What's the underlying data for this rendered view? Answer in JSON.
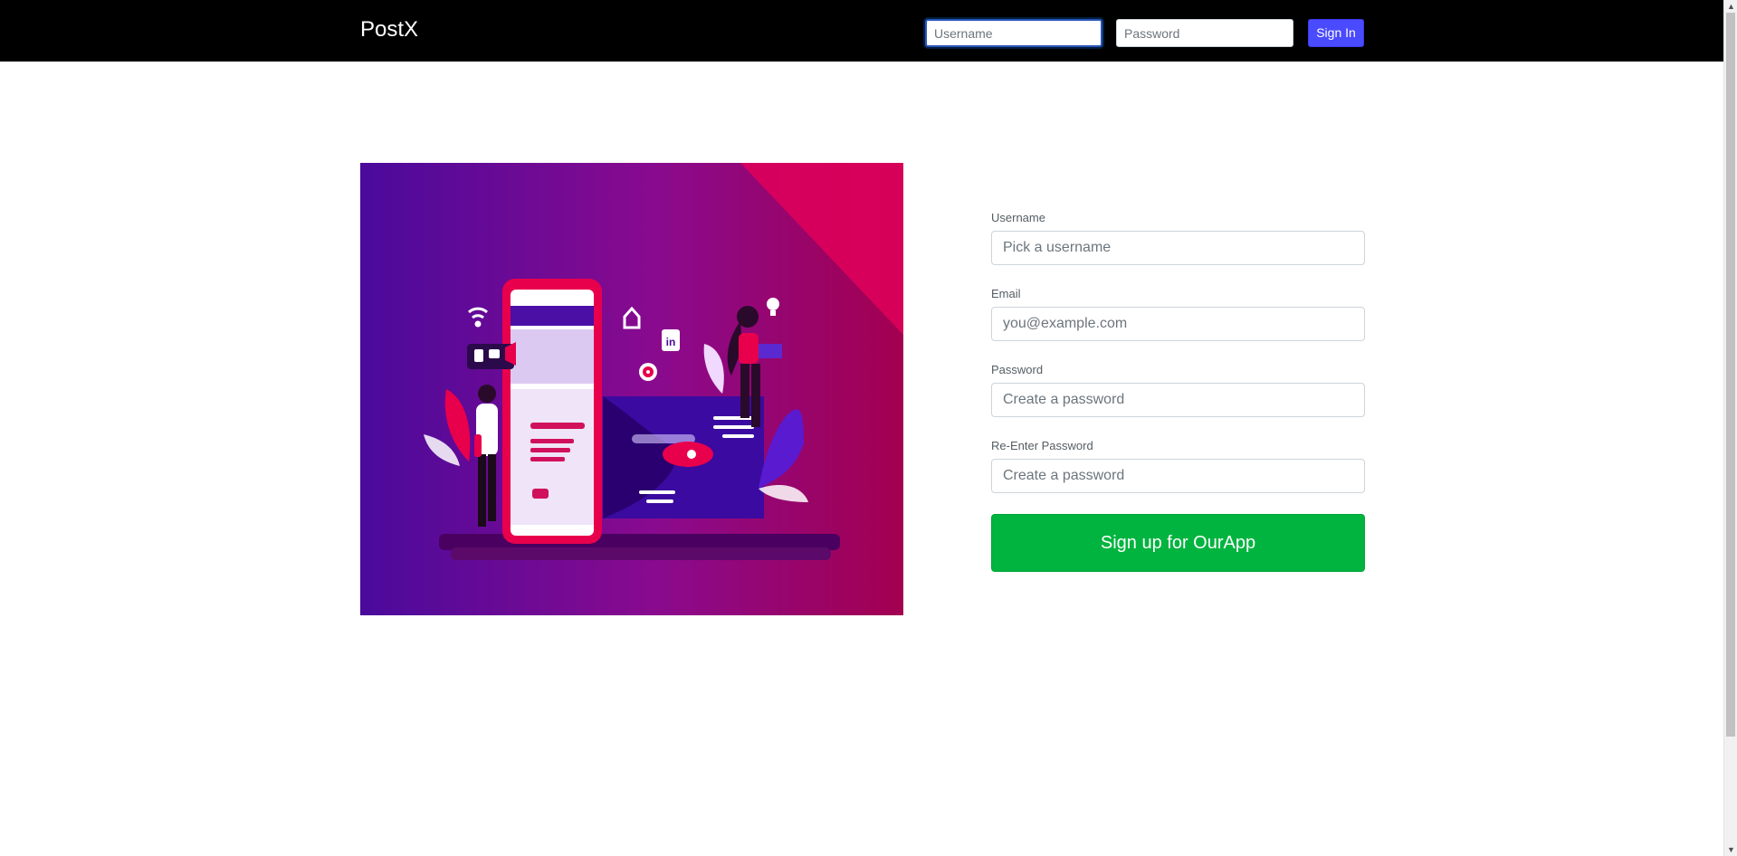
{
  "navbar": {
    "brand": "PostX",
    "username_placeholder": "Username",
    "password_placeholder": "Password",
    "signin_label": "Sign In"
  },
  "hero": {
    "gradient_start": "#4a0fa0",
    "gradient_end": "#a00058",
    "accent": "#e8004c"
  },
  "form": {
    "username_label": "Username",
    "username_placeholder": "Pick a username",
    "email_label": "Email",
    "email_placeholder": "you@example.com",
    "password_label": "Password",
    "password_placeholder": "Create a password",
    "repassword_label": "Re-Enter Password",
    "repassword_placeholder": "Create a password",
    "submit_label": "Sign up for OurApp",
    "submit_color": "#00b43f"
  },
  "icons": [
    "wifi-icon",
    "home-icon",
    "linkedin-icon",
    "lightbulb-icon",
    "target-icon",
    "thumbs-up-icon",
    "chat-icon",
    "megaphone-icon",
    "rocket-icon",
    "scroll-up-arrow-icon",
    "scroll-down-arrow-icon"
  ]
}
